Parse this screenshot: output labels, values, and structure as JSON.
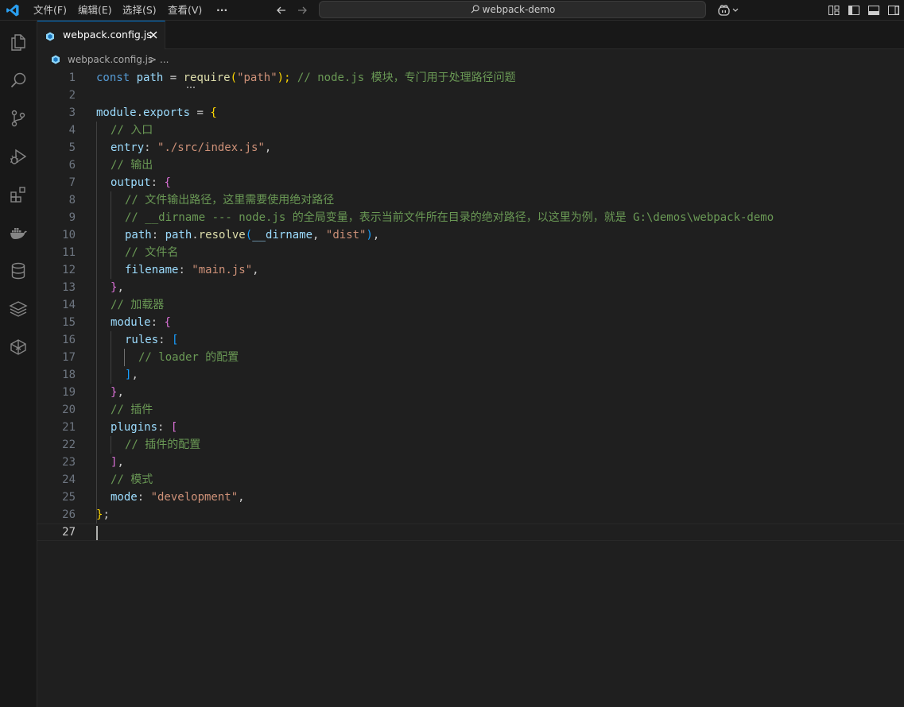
{
  "menu": {
    "file": "文件(F)",
    "edit": "编辑(E)",
    "selection": "选择(S)",
    "view": "查看(V)",
    "more": "···"
  },
  "search": {
    "text": "webpack-demo"
  },
  "tab": {
    "label": "webpack.config.js"
  },
  "breadcrumb": {
    "file": "webpack.config.js",
    "separator": ">",
    "more": "..."
  },
  "editor": {
    "lines": [
      "1",
      "2",
      "3",
      "4",
      "5",
      "6",
      "7",
      "8",
      "9",
      "10",
      "11",
      "12",
      "13",
      "14",
      "15",
      "16",
      "17",
      "18",
      "19",
      "20",
      "21",
      "22",
      "23",
      "24",
      "25",
      "26",
      "27"
    ],
    "code": {
      "l1": [
        "const",
        " ",
        "path",
        " = ",
        "require",
        "(",
        "\"path\"",
        ");",
        " // node.js 模块，专门用于处理路径问题"
      ],
      "l3": [
        "module",
        ".",
        "exports",
        " = ",
        "{"
      ],
      "l4": "// 入口",
      "l5": [
        "entry",
        ": ",
        "\"./src/index.js\"",
        ","
      ],
      "l6": "// 输出",
      "l7": [
        "output",
        ": ",
        "{"
      ],
      "l8": "// 文件输出路径，这里需要使用绝对路径",
      "l9": "// __dirname --- node.js 的全局变量，表示当前文件所在目录的绝对路径，以这里为例，就是 G:\\demos\\webpack-demo",
      "l10": [
        "path",
        ": ",
        "path",
        ".",
        "resolve",
        "(",
        "__dirname",
        ", ",
        "\"dist\"",
        ")",
        ","
      ],
      "l11": "// 文件名",
      "l12": [
        "filename",
        ": ",
        "\"main.js\"",
        ","
      ],
      "l13": [
        "}",
        ","
      ],
      "l14": "// 加载器",
      "l15": [
        "module",
        ": ",
        "{"
      ],
      "l16": [
        "rules",
        ": ",
        "["
      ],
      "l17": "// loader 的配置",
      "l18": [
        "]",
        ","
      ],
      "l19": [
        "}",
        ","
      ],
      "l20": "// 插件",
      "l21": [
        "plugins",
        ": ",
        "["
      ],
      "l22": "// 插件的配置",
      "l23": [
        "]",
        ","
      ],
      "l24": "// 模式",
      "l25": [
        "mode",
        ": ",
        "\"development\"",
        ","
      ],
      "l26": [
        "}",
        ";"
      ]
    }
  },
  "icons": {
    "activity": [
      "explorer-icon",
      "search-icon",
      "source-control-icon",
      "run-debug-icon",
      "extensions-icon",
      "docker-icon",
      "database-icon",
      "layers-icon",
      "remote-icon"
    ],
    "titlebar": [
      "vscode-logo-icon",
      "back-arrow-icon",
      "forward-arrow-icon",
      "copilot-icon",
      "customize-layout-icon",
      "toggle-sidebar-icon",
      "toggle-panel-icon",
      "toggle-secondary-sidebar-icon"
    ]
  },
  "colors": {
    "accent": "#0078d4",
    "background": "#1f1f1f",
    "keyword": "#569cd6",
    "string": "#ce9178",
    "comment": "#6a9955",
    "function": "#dcdcaa",
    "property": "#9cdcfe"
  }
}
